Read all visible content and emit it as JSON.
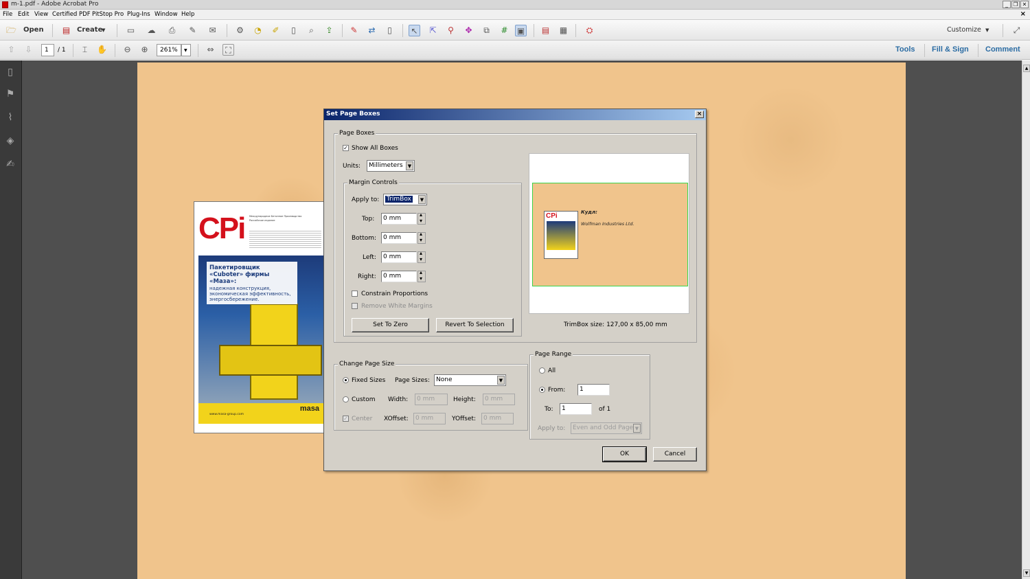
{
  "window": {
    "title": "m-1.pdf - Adobe Acrobat Pro",
    "min": "_",
    "restore": "❐",
    "close": "✕"
  },
  "menu": [
    "File",
    "Edit",
    "View",
    "Certified PDF",
    "PitStop Pro",
    "Plug-Ins",
    "Window",
    "Help"
  ],
  "menu_close": "×",
  "toolbar": {
    "open_label": "Open",
    "create_label": "Create",
    "customize_label": "Customize"
  },
  "nav": {
    "page_current": "1",
    "page_total": "/ 1",
    "zoom": "261%",
    "tools": "Tools",
    "fill_sign": "Fill & Sign",
    "comment": "Comment"
  },
  "brochure": {
    "logo": "CPi",
    "small_title": "Международное Бетонное Производство",
    "small_subtitle": "Российское издание",
    "headline": "Пакетировщик «Cuboter» фирмы «Маза»:",
    "body": "надежная конструкция, экономическая эффективность, энергосбережение.",
    "brand": "masa",
    "url": "www.masa-group.com"
  },
  "dialog": {
    "title": "Set Page Boxes",
    "page_boxes": {
      "group_label": "Page Boxes",
      "show_all_boxes": "Show All Boxes",
      "show_all_boxes_checked": true,
      "units_label": "Units:",
      "units_value": "Millimeters"
    },
    "margin_controls": {
      "group_label": "Margin Controls",
      "apply_to_label": "Apply to:",
      "apply_to_value": "TrimBox",
      "top_label": "Top:",
      "top_value": "0 mm",
      "bottom_label": "Bottom:",
      "bottom_value": "0 mm",
      "left_label": "Left:",
      "left_value": "0 mm",
      "right_label": "Right:",
      "right_value": "0 mm",
      "constrain": "Constrain Proportions",
      "remove_white": "Remove White Margins",
      "set_to_zero": "Set To Zero",
      "revert": "Revert To Selection"
    },
    "preview": {
      "line1": "Кудл:",
      "line2": "Wolfman Industries Ltd.",
      "size_label": "TrimBox size: 127,00 x 85,00 mm"
    },
    "change_page_size": {
      "group_label": "Change Page Size",
      "fixed_sizes": "Fixed Sizes",
      "page_sizes_label": "Page Sizes:",
      "page_sizes_value": "None",
      "custom": "Custom",
      "width_label": "Width:",
      "width_value": "0 mm",
      "height_label": "Height:",
      "height_value": "0 mm",
      "center": "Center",
      "xoffset_label": "XOffset:",
      "xoffset_value": "0 mm",
      "yoffset_label": "YOffset:",
      "yoffset_value": "0 mm"
    },
    "page_range": {
      "group_label": "Page Range",
      "all": "All",
      "from_label": "From:",
      "from_value": "1",
      "to_label": "To:",
      "to_value": "1",
      "of_label": "of 1",
      "apply_to_label": "Apply to:",
      "apply_to_value": "Even and Odd Pages"
    },
    "ok": "OK",
    "cancel": "Cancel"
  }
}
